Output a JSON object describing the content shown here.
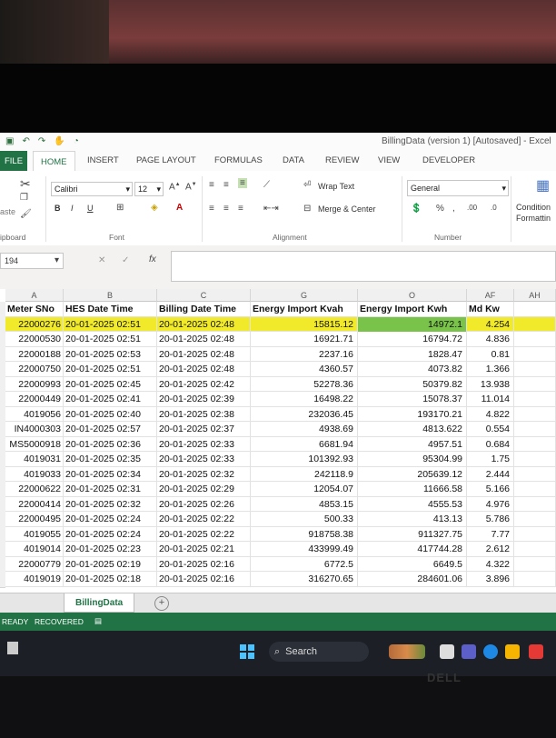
{
  "window": {
    "title": "BillingData (version 1) [Autosaved] - Excel"
  },
  "ribbon": {
    "tabs": [
      "FILE",
      "HOME",
      "INSERT",
      "PAGE LAYOUT",
      "FORMULAS",
      "DATA",
      "REVIEW",
      "VIEW",
      "DEVELOPER"
    ],
    "active_tab": "HOME",
    "paste_label": "aste",
    "font_name": "Calibri",
    "font_size": "12",
    "bold": "B",
    "italic": "I",
    "underline": "U",
    "wrap_text": "Wrap Text",
    "merge_center": "Merge & Center",
    "number_format": "General",
    "conditional_formatting": "Condition\nFormattin",
    "groups": {
      "clipboard": "ipboard",
      "font": "Font",
      "alignment": "Alignment",
      "number": "Number"
    }
  },
  "formula_bar": {
    "name_box": "194",
    "fx": "fx",
    "content": ""
  },
  "grid": {
    "column_letters": [
      "A",
      "B",
      "C",
      "G",
      "O",
      "AF",
      "AH"
    ],
    "row_headers": [
      "",
      "",
      "",
      "",
      "",
      "",
      "",
      "",
      "",
      "",
      "",
      "",
      "",
      "",
      "",
      "",
      "",
      "",
      ""
    ],
    "headers": [
      "Meter SNo",
      "HES Date Time",
      "Billing Date Time",
      "Energy Import Kvah",
      "Energy Import Kwh",
      "Md Kw"
    ],
    "rows": [
      [
        "22000276",
        "20-01-2025 02:51",
        "20-01-2025 02:48",
        "15815.12",
        "14972.1",
        "4.254"
      ],
      [
        "22000530",
        "20-01-2025 02:51",
        "20-01-2025 02:48",
        "16921.71",
        "16794.72",
        "4.836"
      ],
      [
        "22000188",
        "20-01-2025 02:53",
        "20-01-2025 02:48",
        "2237.16",
        "1828.47",
        "0.81"
      ],
      [
        "22000750",
        "20-01-2025 02:51",
        "20-01-2025 02:48",
        "4360.57",
        "4073.82",
        "1.366"
      ],
      [
        "22000993",
        "20-01-2025 02:45",
        "20-01-2025 02:42",
        "52278.36",
        "50379.82",
        "13.938"
      ],
      [
        "22000449",
        "20-01-2025 02:41",
        "20-01-2025 02:39",
        "16498.22",
        "15078.37",
        "11.014"
      ],
      [
        "4019056",
        "20-01-2025 02:40",
        "20-01-2025 02:38",
        "232036.45",
        "193170.21",
        "4.822"
      ],
      [
        "IN4000303",
        "20-01-2025 02:57",
        "20-01-2025 02:37",
        "4938.69",
        "4813.622",
        "0.554"
      ],
      [
        "MS5000918",
        "20-01-2025 02:36",
        "20-01-2025 02:33",
        "6681.94",
        "4957.51",
        "0.684"
      ],
      [
        "4019031",
        "20-01-2025 02:35",
        "20-01-2025 02:33",
        "101392.93",
        "95304.99",
        "1.75"
      ],
      [
        "4019033",
        "20-01-2025 02:34",
        "20-01-2025 02:32",
        "242118.9",
        "205639.12",
        "2.444"
      ],
      [
        "22000622",
        "20-01-2025 02:31",
        "20-01-2025 02:29",
        "12054.07",
        "11666.58",
        "5.166"
      ],
      [
        "22000414",
        "20-01-2025 02:32",
        "20-01-2025 02:26",
        "4853.15",
        "4555.53",
        "4.976"
      ],
      [
        "22000495",
        "20-01-2025 02:24",
        "20-01-2025 02:22",
        "500.33",
        "413.13",
        "5.786"
      ],
      [
        "4019055",
        "20-01-2025 02:24",
        "20-01-2025 02:22",
        "918758.38",
        "911327.75",
        "7.77"
      ],
      [
        "4019014",
        "20-01-2025 02:23",
        "20-01-2025 02:21",
        "433999.49",
        "417744.28",
        "2.612"
      ],
      [
        "22000779",
        "20-01-2025 02:19",
        "20-01-2025 02:16",
        "6772.5",
        "6649.5",
        "4.322"
      ],
      [
        "4019019",
        "20-01-2025 02:18",
        "20-01-2025 02:16",
        "316270.65",
        "284601.06",
        "3.896"
      ]
    ],
    "highlight_color": "#f1ea2a",
    "selected_color": "#79c34a"
  },
  "sheets": {
    "tabs": [
      "BillingData"
    ],
    "add": "+"
  },
  "status": {
    "ready": "READY",
    "recovered": "RECOVERED"
  },
  "taskbar": {
    "search_label": "Search"
  },
  "accent": "#217346"
}
